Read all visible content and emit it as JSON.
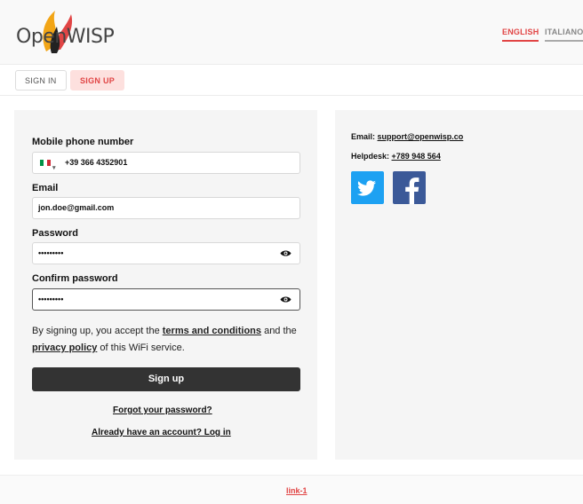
{
  "header": {
    "logo_text": "OpenWISP",
    "languages": [
      "ENGLISH",
      "ITALIANO"
    ]
  },
  "tabs": {
    "signin": "SIGN IN",
    "signup": "SIGN UP"
  },
  "form": {
    "phone_label": "Mobile phone number",
    "phone_value": "+39 366 4352901",
    "email_label": "Email",
    "email_value": "jon.doe@gmail.com",
    "password_label": "Password",
    "password_value": "•••••••••",
    "confirm_label": "Confirm password",
    "confirm_value": "•••••••••",
    "terms_prefix": "By signing up, you accept the ",
    "terms_link": "terms and conditions",
    "terms_mid": " and the ",
    "privacy_link": "privacy policy",
    "terms_suffix": " of this WiFi service.",
    "submit": "Sign up",
    "forgot": "Forgot your password?",
    "login": "Already have an account? Log in"
  },
  "contact": {
    "email_label": "Email: ",
    "email_value": "support@openwisp.co",
    "helpdesk_label": "Helpdesk: ",
    "helpdesk_value": "+789 948 564"
  },
  "social": [
    "twitter-icon",
    "facebook-icon"
  ],
  "footer": {
    "link": "link-1"
  },
  "colors": {
    "accent": "#e14545",
    "button": "#333333",
    "twitter": "#1da1f2",
    "facebook": "#3b5998"
  }
}
